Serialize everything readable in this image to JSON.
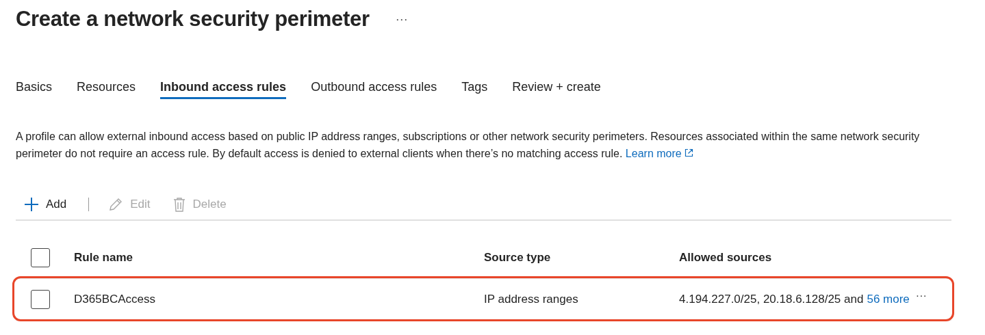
{
  "page": {
    "title": "Create a network security perimeter",
    "more_menu": "···"
  },
  "tabs": [
    {
      "label": "Basics",
      "selected": false
    },
    {
      "label": "Resources",
      "selected": false
    },
    {
      "label": "Inbound access rules",
      "selected": true
    },
    {
      "label": "Outbound access rules",
      "selected": false
    },
    {
      "label": "Tags",
      "selected": false
    },
    {
      "label": "Review + create",
      "selected": false
    }
  ],
  "description": {
    "text": "A profile can allow external inbound access based on public IP address ranges, subscriptions or other network security perimeters. Resources associated within the same network security perimeter do not require an access rule. By default access is denied to external clients when there’s no matching access rule.",
    "link": "Learn more"
  },
  "toolbar": [
    {
      "kind": "add",
      "label": "Add",
      "disabled": false
    },
    {
      "kind": "edit",
      "label": "Edit",
      "disabled": true
    },
    {
      "kind": "delete",
      "label": "Delete",
      "disabled": true
    }
  ],
  "table": {
    "select_all_checked": false,
    "columns": [
      "Rule name",
      "Source type",
      "Allowed sources"
    ],
    "rows": [
      {
        "checked": false,
        "highlighted": true,
        "rule_name": "D365BCAccess",
        "source_type": "IP address ranges",
        "allowed_sources": "4.194.227.0/25, 20.18.6.128/25 and",
        "more_link": "56 more",
        "row_menu": "···"
      }
    ]
  }
}
